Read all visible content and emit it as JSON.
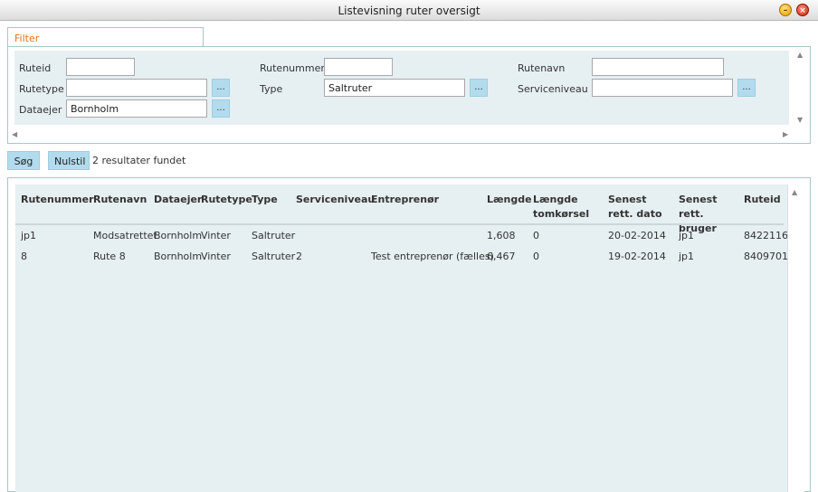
{
  "window": {
    "title": "Listevisning ruter oversigt",
    "minimize_glyph": "–",
    "close_glyph": "×"
  },
  "filter": {
    "tab_label": "Filter",
    "dots_label": "...",
    "fields": {
      "ruteid": {
        "label": "Ruteid",
        "value": ""
      },
      "rutenummer": {
        "label": "Rutenummer",
        "value": ""
      },
      "rutenavn": {
        "label": "Rutenavn",
        "value": ""
      },
      "rutetype": {
        "label": "Rutetype",
        "value": ""
      },
      "type": {
        "label": "Type",
        "value": "Saltruter"
      },
      "serviceniveau": {
        "label": "Serviceniveau",
        "value": ""
      },
      "dataejer": {
        "label": "Dataejer",
        "value": "Bornholm"
      }
    }
  },
  "actions": {
    "search_label": "Søg",
    "reset_label": "Nulstil",
    "result_count": "2 resultater fundet"
  },
  "table": {
    "columns": {
      "rutenummer": "Rutenummer",
      "rutenavn": "Rutenavn",
      "dataejer": "Dataejer",
      "rutetype": "Rutetype",
      "type": "Type",
      "serviceniveau": "Serviceniveau",
      "entreprenor": "Entreprenør",
      "laengde": "Længde",
      "laengde_tom": "Længde tomkørsel",
      "senest_dato": "Senest rett. dato",
      "senest_bruger": "Senest rett. bruger",
      "ruteid": "Ruteid"
    },
    "rows": [
      {
        "rutenummer": "jp1",
        "rutenavn": "Modsatrettet",
        "dataejer": "Bornholm",
        "rutetype": "Vinter",
        "type": "Saltruter",
        "serviceniveau": "",
        "entreprenor": "",
        "laengde": "1,608",
        "laengde_tom": "0",
        "senest_dato": "20-02-2014",
        "senest_bruger": "jp1",
        "ruteid": "8422116"
      },
      {
        "rutenummer": "8",
        "rutenavn": "Rute 8",
        "dataejer": "Bornholm",
        "rutetype": "Vinter",
        "type": "Saltruter",
        "serviceniveau": "2",
        "entreprenor": "Test entreprenør (fælles)",
        "laengde": "6,467",
        "laengde_tom": "0",
        "senest_dato": "19-02-2014",
        "senest_bruger": "jp1",
        "ruteid": "8409701"
      }
    ]
  },
  "icons": {
    "scroll_up": "▲",
    "scroll_down": "▼",
    "scroll_left": "◀",
    "scroll_right": "▶"
  }
}
